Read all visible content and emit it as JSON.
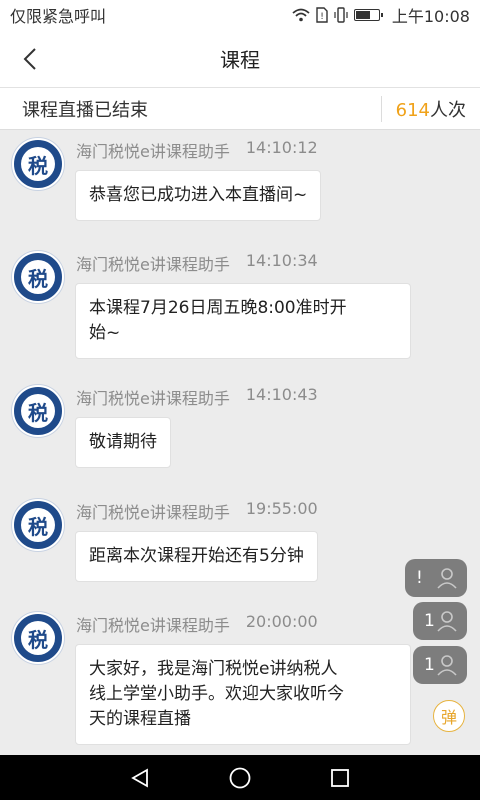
{
  "status_bar": {
    "carrier": "仅限紧急呼叫",
    "time": "上午10:08",
    "icons": [
      "wifi-icon",
      "sim-alert-icon",
      "vibrate-icon",
      "battery-icon"
    ]
  },
  "navbar": {
    "title": "课程",
    "back_icon": "chevron-left-icon"
  },
  "live_status": {
    "text": "课程直播已结束",
    "count": "614",
    "count_unit": "人次"
  },
  "messages": [
    {
      "sender": "海门税悦e讲课程助手",
      "time": "14:10:12",
      "text": "恭喜您已成功进入本直播间~",
      "avatar_char": "税"
    },
    {
      "sender": "海门税悦e讲课程助手",
      "time": "14:10:34",
      "text": "本课程7月26日周五晚8:00准时开始~",
      "text_lines": [
        "本课程7月26日周五晚8:00准时开",
        "始~"
      ],
      "avatar_char": "税"
    },
    {
      "sender": "海门税悦e讲课程助手",
      "time": "14:10:43",
      "text": "敬请期待",
      "avatar_char": "税"
    },
    {
      "sender": "海门税悦e讲课程助手",
      "time": "19:55:00",
      "text": "距离本次课程开始还有5分钟",
      "avatar_char": "税"
    },
    {
      "sender": "海门税悦e讲课程助手",
      "time": "20:00:00",
      "text": "大家好，我是海门税悦e讲纳税人线上学堂小助手。欢迎大家收听今天的课程直播",
      "text_lines": [
        "大家好，我是海门税悦e讲纳税人",
        "线上学堂小助手。欢迎大家收听今",
        "天的课程直播"
      ],
      "avatar_char": "税"
    }
  ],
  "float_buttons": [
    {
      "label": "!",
      "icon": "person-icon"
    },
    {
      "label": "1",
      "icon": "person-icon"
    },
    {
      "label": "1",
      "icon": "person-icon"
    }
  ],
  "danmu_button": {
    "label": "弹"
  },
  "system_nav": {
    "icons": [
      "back-triangle-icon",
      "home-circle-icon",
      "recents-square-icon"
    ]
  },
  "colors": {
    "accent": "#f0a21a",
    "avatar_blue": "#1f4a8a",
    "background": "#ececec"
  }
}
